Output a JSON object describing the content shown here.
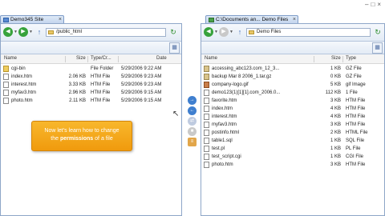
{
  "tabs": {
    "left": "Demo345 Site",
    "right": "C:\\Documents an... Demo Files"
  },
  "left_pane": {
    "path": "/public_html",
    "columns": [
      "Name",
      "Size",
      "Type/Cr...",
      "Date"
    ],
    "rows": [
      {
        "icon": "folder-icon",
        "name": "cgi-bin",
        "size": "",
        "type": "File Folder",
        "date": "5/29/2006 9:22 AM"
      },
      {
        "icon": "file-icon",
        "name": "index.htm",
        "size": "2.06 KB",
        "type": "HTM File",
        "date": "5/29/2006 9:23 AM"
      },
      {
        "icon": "file-icon",
        "name": "interest.htm",
        "size": "3.33 KB",
        "type": "HTM File",
        "date": "5/29/2006 9:23 AM"
      },
      {
        "icon": "file-icon",
        "name": "myfav3.htm",
        "size": "2.96 KB",
        "type": "HTM File",
        "date": "5/29/2006 9:15 AM"
      },
      {
        "icon": "file-icon",
        "name": "photo.htm",
        "size": "2.11 KB",
        "type": "HTM File",
        "date": "5/29/2006 9:15 AM"
      }
    ]
  },
  "right_pane": {
    "path": "Demo Files",
    "columns": [
      "Name",
      "Size",
      "Type"
    ],
    "rows": [
      {
        "icon": "archive-icon",
        "name": "accessing_abc123.com_12_3...",
        "size": "1 KB",
        "type": "GZ File"
      },
      {
        "icon": "archive-icon",
        "name": "backup Mar 8 2006_1.tar.gz",
        "size": "0 KB",
        "type": "GZ File"
      },
      {
        "icon": "image-icon",
        "name": "company-logo.gif",
        "size": "5 KB",
        "type": "gif Image"
      },
      {
        "icon": "file-icon",
        "name": "demo123(1)[1][1].com_2006.0...",
        "size": "112 KB",
        "type": "1 File"
      },
      {
        "icon": "file-icon",
        "name": "favorite.htm",
        "size": "3 KB",
        "type": "HTM File"
      },
      {
        "icon": "file-icon",
        "name": "index.htm",
        "size": "4 KB",
        "type": "HTM File"
      },
      {
        "icon": "file-icon",
        "name": "interest.htm",
        "size": "4 KB",
        "type": "HTM File"
      },
      {
        "icon": "file-icon",
        "name": "myfav3.htm",
        "size": "3 KB",
        "type": "HTM File"
      },
      {
        "icon": "file-icon",
        "name": "postinfo.html",
        "size": "2 KB",
        "type": "HTML File"
      },
      {
        "icon": "file-icon",
        "name": "table1.sql",
        "size": "1 KB",
        "type": "SQL File"
      },
      {
        "icon": "file-icon",
        "name": "test.pl",
        "size": "1 KB",
        "type": "PL File"
      },
      {
        "icon": "file-icon",
        "name": "test_script.cgi",
        "size": "1 KB",
        "type": "CGI File"
      },
      {
        "icon": "file-icon",
        "name": "photo.htm",
        "size": "3 KB",
        "type": "HTM File"
      }
    ]
  },
  "tooltip": {
    "line1": "Now let's learn how to change",
    "line2_prefix": "the",
    "line2_bold": "permissions",
    "line2_suffix": "of a file"
  },
  "colors": {
    "tooltip_bg": "#f5a623",
    "nav_green": "#37a23b",
    "pane_border": "#8ea6c8"
  }
}
